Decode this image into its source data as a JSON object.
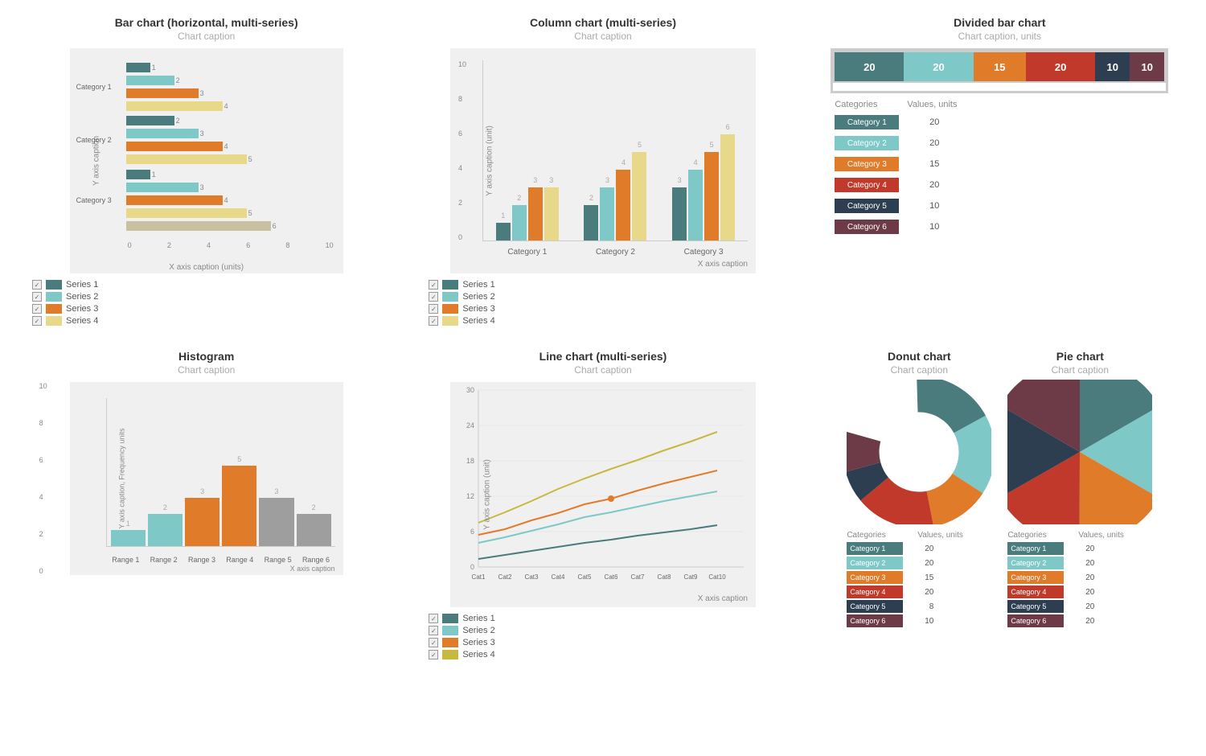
{
  "colors": {
    "series1": "#4a7c7e",
    "series2": "#7ec8c8",
    "series3": "#e07b2a",
    "series4": "#e8d88a",
    "cat1": "#4a7c7e",
    "cat2": "#7ec8c8",
    "cat3": "#e07b2a",
    "cat4": "#c0392b",
    "cat5": "#2c3e50",
    "cat6": "#6d3b47",
    "hist1": "#7ec8c8",
    "hist2": "#e07b2a",
    "hist3": "#9e9e9e"
  },
  "hbar": {
    "title": "Bar chart (horizontal, multi-series)",
    "caption": "Chart caption",
    "yLabel": "Y axis caption",
    "xLabel": "X axis caption (units)",
    "xTicks": [
      "0",
      "2",
      "4",
      "6",
      "8",
      "10"
    ],
    "categories": [
      "Category 1",
      "Category 2",
      "Category 3"
    ],
    "series": [
      "Series 1",
      "Series 2",
      "Series 3",
      "Series 4"
    ],
    "data": [
      [
        1,
        2,
        3,
        4
      ],
      [
        2,
        3,
        4,
        5
      ],
      [
        1,
        3,
        4,
        5,
        6
      ]
    ]
  },
  "colchart": {
    "title": "Column chart (multi-series)",
    "caption": "Chart caption",
    "yLabel": "Y axis caption (unit)",
    "xLabel": "X axis caption",
    "yTicks": [
      "0",
      "2",
      "4",
      "6",
      "8",
      "10"
    ],
    "xCategories": [
      "Category 1",
      "Category 2",
      "Category 3"
    ],
    "series": [
      "Series 1",
      "Series 2",
      "Series 3",
      "Series 4"
    ],
    "data": [
      [
        1,
        2,
        3,
        3
      ],
      [
        2,
        3,
        4,
        5
      ],
      [
        3,
        4,
        5,
        6
      ]
    ]
  },
  "dividedbar": {
    "title": "Divided bar chart",
    "caption": "Chart caption, units",
    "segments": [
      {
        "label": "20",
        "value": 20,
        "color": "#4a7c7e",
        "name": "Category 1"
      },
      {
        "label": "20",
        "value": 20,
        "color": "#7ec8c8",
        "name": "Category 2"
      },
      {
        "label": "15",
        "value": 15,
        "color": "#e07b2a",
        "name": "Category 3"
      },
      {
        "label": "20",
        "value": 20,
        "color": "#c0392b",
        "name": "Category 4"
      },
      {
        "label": "10",
        "value": 10,
        "color": "#2c3e50",
        "name": "Category 5"
      },
      {
        "label": "10",
        "value": 10,
        "color": "#6d3b47",
        "name": "Category 6"
      }
    ],
    "headerCat": "Categories",
    "headerVal": "Values, units"
  },
  "histogram": {
    "title": "Histogram",
    "caption": "Chart caption",
    "yLabel": "Y axis caption, Frequency units",
    "xLabel": "X axis caption",
    "yTicks": [
      "0",
      "2",
      "4",
      "6",
      "8",
      "10"
    ],
    "bars": [
      {
        "label": "Range 1",
        "value": 1,
        "color": "#7ec8c8"
      },
      {
        "label": "Range 2",
        "value": 2,
        "color": "#7ec8c8"
      },
      {
        "label": "Range 3",
        "value": 3,
        "color": "#e07b2a"
      },
      {
        "label": "Range 4",
        "value": 5,
        "color": "#e07b2a"
      },
      {
        "label": "Range 5",
        "value": 3,
        "color": "#9e9e9e"
      },
      {
        "label": "Range 6",
        "value": 2,
        "color": "#9e9e9e"
      }
    ]
  },
  "linechart": {
    "title": "Line chart (multi-series)",
    "caption": "Chart caption",
    "yLabel": "Y axis caption (unit)",
    "xLabel": "X axis caption",
    "yTicks": [
      "0",
      "6",
      "12",
      "18",
      "24",
      "30"
    ],
    "xTicks": [
      "Cat1",
      "Cat2",
      "Cat3",
      "Cat4",
      "Cat5",
      "Cat6",
      "Cat7",
      "Cat8",
      "Cat9",
      "Cat10"
    ],
    "series": [
      "Series 1",
      "Series 2",
      "Series 3",
      "Series 4"
    ]
  },
  "donut": {
    "title": "Donut chart",
    "caption": "Chart caption",
    "headerCat": "Categories",
    "headerVal": "Values, units",
    "segments": [
      {
        "name": "Category 1",
        "value": 20,
        "color": "#4a7c7e"
      },
      {
        "name": "Category 2",
        "value": 20,
        "color": "#7ec8c8"
      },
      {
        "name": "Category 3",
        "value": 15,
        "color": "#e07b2a"
      },
      {
        "name": "Category 4",
        "value": 20,
        "color": "#c0392b"
      },
      {
        "name": "Category 5",
        "value": 8,
        "color": "#2c3e50"
      },
      {
        "name": "Category 6",
        "value": 10,
        "color": "#6d3b47"
      }
    ]
  },
  "pie": {
    "title": "Pie chart",
    "caption": "Chart caption",
    "headerCat": "Categories",
    "headerVal": "Values, units",
    "segments": [
      {
        "name": "Category 1",
        "value": 20,
        "color": "#4a7c7e"
      },
      {
        "name": "Category 2",
        "value": 20,
        "color": "#7ec8c8"
      },
      {
        "name": "Category 3",
        "value": 20,
        "color": "#e07b2a"
      },
      {
        "name": "Category 4",
        "value": 20,
        "color": "#c0392b"
      },
      {
        "name": "Category 5",
        "value": 20,
        "color": "#2c3e50"
      },
      {
        "name": "Category 6",
        "value": 20,
        "color": "#6d3b47"
      }
    ]
  }
}
